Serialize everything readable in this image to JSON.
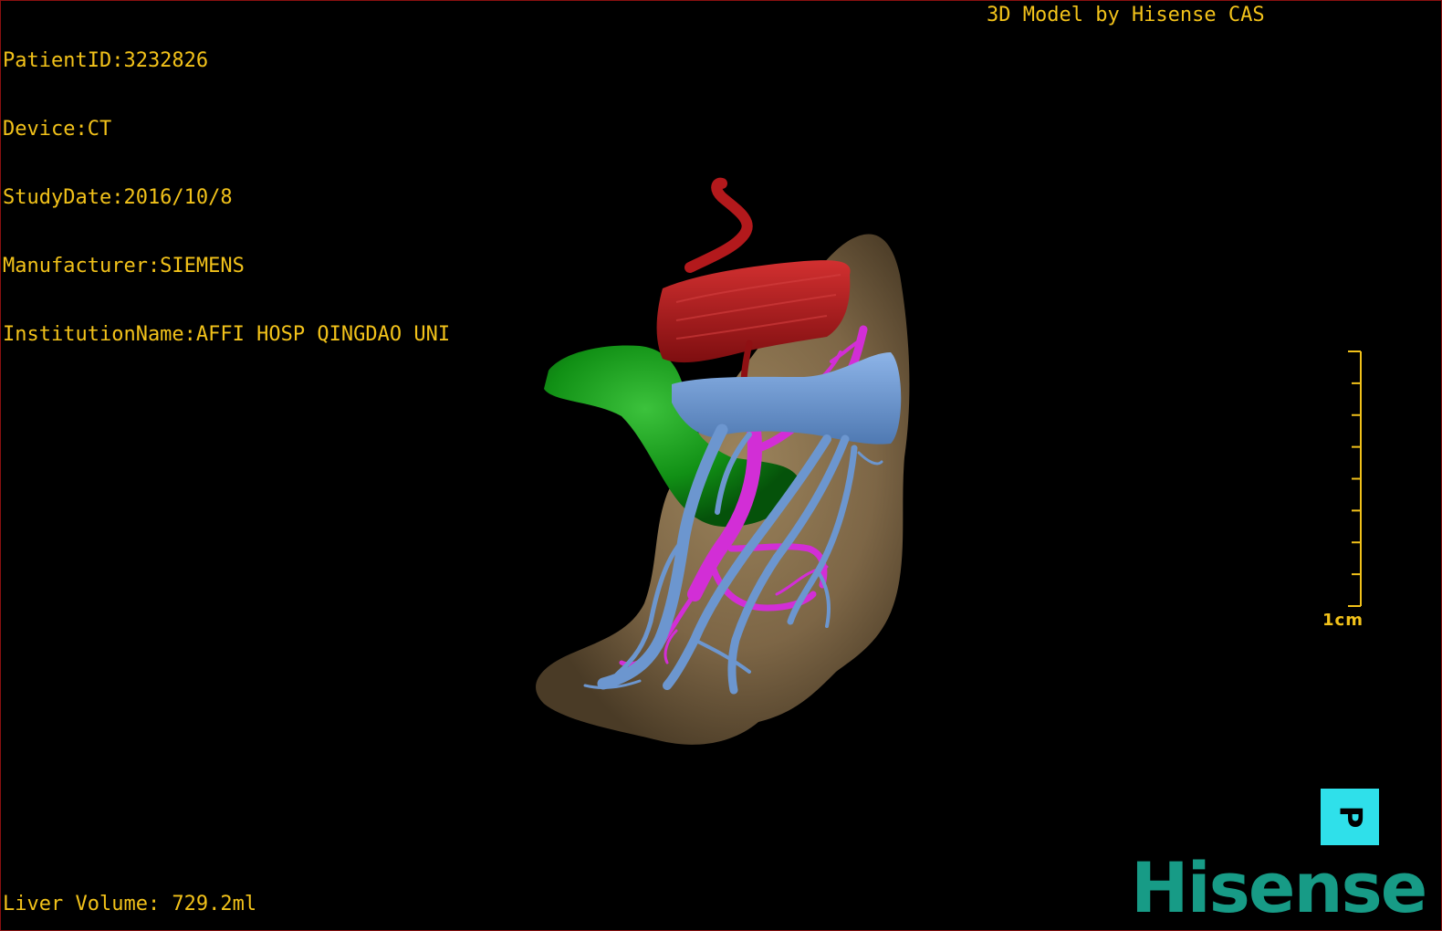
{
  "study_info": {
    "patient_id": "PatientID:3232826",
    "device": "Device:CT",
    "study_date": "StudyDate:2016/10/8",
    "manufacturer": "Manufacturer:SIEMENS",
    "institution": "InstitutionName:AFFI HOSP QINGDAO UNI"
  },
  "header": {
    "credit": "3D Model by Hisense CAS"
  },
  "footer": {
    "volume": "Liver Volume: 729.2ml"
  },
  "scale": {
    "label": "1cm",
    "ticks": 9
  },
  "orientation": {
    "label": "P"
  },
  "brand": {
    "logo_text": "Hisense"
  },
  "colors": {
    "overlay_text": "#f2c21a",
    "liver": "#8a7150",
    "artery": "#b3191c",
    "gallbladder": "#169a17",
    "portal_vein": "#d22ed6",
    "hepatic_vein": "#6c96cf",
    "orientation_cube": "#2fe0ea",
    "brand": "#179b86"
  },
  "structures": [
    "liver",
    "hepatic-artery",
    "gallbladder",
    "portal-vein",
    "hepatic-vein"
  ]
}
